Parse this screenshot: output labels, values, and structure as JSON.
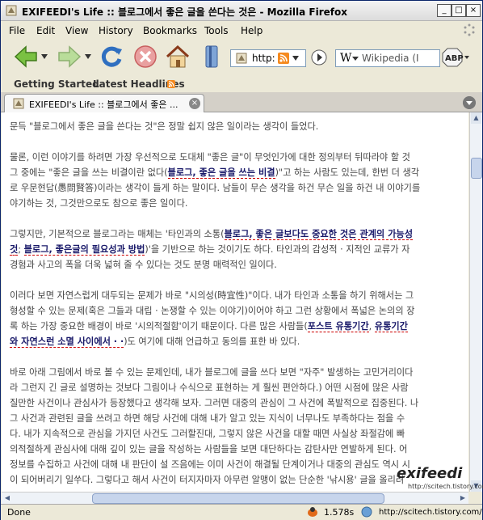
{
  "window": {
    "title": "EXIFEEDI's Life :: 블로그에서 좋은 글을 쓴다는 것은 - Mozilla Firefox",
    "controls": {
      "minimize": "_",
      "maximize": "□",
      "close": "×"
    }
  },
  "menu": [
    "File",
    "Edit",
    "View",
    "History",
    "Bookmarks",
    "Tools",
    "Help"
  ],
  "navbar": {
    "url_text": "http:",
    "search_placeholder": "Wikipedia (I",
    "search_engine_letter": "W",
    "icons": [
      "back-arrow-icon",
      "forward-arrow-icon",
      "reload-icon",
      "stop-icon",
      "home-icon",
      "bookmarks-icon",
      "rss-icon",
      "go-icon",
      "adblock-icon"
    ],
    "adblock_label": "ABP"
  },
  "bookmarks": [
    "Getting Started",
    "Latest Headlines"
  ],
  "tab": {
    "title": "EXIFEEDI's Life :: 블로그에서 좋은 ...",
    "close": "×"
  },
  "article": {
    "p1": "문득 \"블로그에서 좋은 글을 쓴다는 것\"은 정말 쉽지 않은 일이라는 생각이 들었다.",
    "p2": [
      {
        "a": "물론, 이런 이야기를 하려면 가장 우선적으로 도대체 \"좋은 글\"이 무엇인가에 대한 정의부터 뒤따라야 할 것"
      },
      {
        "a": "그 중에는 \"좋은 글을 쓰는 비결이란 없다(",
        "h": "블로그, 좋은 글을 쓰는 비결",
        "b": ")\"고 하는 사람도 있는데, 한번 더 생각"
      },
      {
        "a": "로 우문현답(愚問賢答)이라는 생각이 들게 하는 말이다. 남들이 무슨 생각을 하건 무슨 일을 하건 내 이야기를"
      },
      {
        "a": "야기하는 것, 그것만으로도 참으로 좋은 일이다."
      }
    ],
    "p3": [
      {
        "a": "그렇지만, 기본적으로 블로그라는 매체는 '타인과의 소통(",
        "h": "블로그, 좋은 글보다도 중요한 것은 관계의 가능성"
      },
      {
        "h": "것",
        "a": "; ",
        "h2": "블로그, 좋은글의 필요성과 방법",
        "b": ")'을 기반으로 하는 것이기도 하다. 타인과의 감성적 · 지적인 교류가 자"
      },
      {
        "a": "경험과 사고의 폭을 더욱 넓혀 줄 수 있다는 것도 분명 매력적인 일이다."
      }
    ],
    "p4": [
      {
        "a": "이러다 보면 자연스럽게 대두되는 문제가 바로 \"시의성(時宜性)\"이다. 내가 타인과 소통을 하기 위해서는 그"
      },
      {
        "a": "형성할 수 있는 문제(혹은 그들과 대립 · 논쟁할 수 있는 이야기)이어야 하고 그런 상황에서 폭넓은 논의의 장"
      },
      {
        "a": "록 하는 가장 중요한 배경이 바로 '시의적절함'이기 때문이다. 다른 많은 사람들(",
        "h": "포스트 유통기간",
        "b": ", ",
        "h2": "유통기간"
      },
      {
        "h": "와 자연스런 소멸 사이에서 · ·",
        "a": ")도 여기에 대해 언급하고 동의를 표한 바 있다."
      }
    ],
    "p5": [
      {
        "a": "바로 아래 그림에서 바로 볼 수 있는 문제인데, 내가 블로그에 글을 쓰다 보면 \"자주\" 발생하는 고민거리이다"
      },
      {
        "a": "라 그런지 긴 글로 설명하는 것보다 그림이나 수식으로 표현하는 게 훨씬 편안하다.) 어떤 시점에 많은 사람"
      },
      {
        "a": "질만한 사건이나 관심사가 등장했다고 생각해 보자. 그러면 대중의 관심이 그 사건에 폭발적으로 집중된다. 나"
      },
      {
        "a": "그 사건과 관련된 글을 쓰려고 하면 해당 사건에 대해 내가 알고 있는 지식이 너무나도 부족하다는 점을 수"
      },
      {
        "a": "다. 내가 지속적으로 관심을 가지던 사건도 그러할진대, 그렇지 않은 사건을 대할 때면 사실상 좌절감에 빠"
      },
      {
        "a": "의적절하게 관심사에 대해 깊이 있는 글을 작성하는 사람들을 보면 대단하다는 감탄사만 연발하게 된다. 어"
      },
      {
        "a": "정보를 수집하고 사건에 대해 내 판단이 설 즈음에는 이미 사건이 해결될 단계이거나 대중의 관심도 역시 시"
      },
      {
        "a": "이 되어버리기 일쑤다. 그렇다고 해서 사건이 터지자마자 아무런 알맹이 없는 단순한 '낚시용' 글을 올리려"
      }
    ]
  },
  "logo": {
    "title": "exifeedi",
    "url": "http://scitech.tistory.com/"
  },
  "status": {
    "text": "Done",
    "time": "1.578s"
  }
}
